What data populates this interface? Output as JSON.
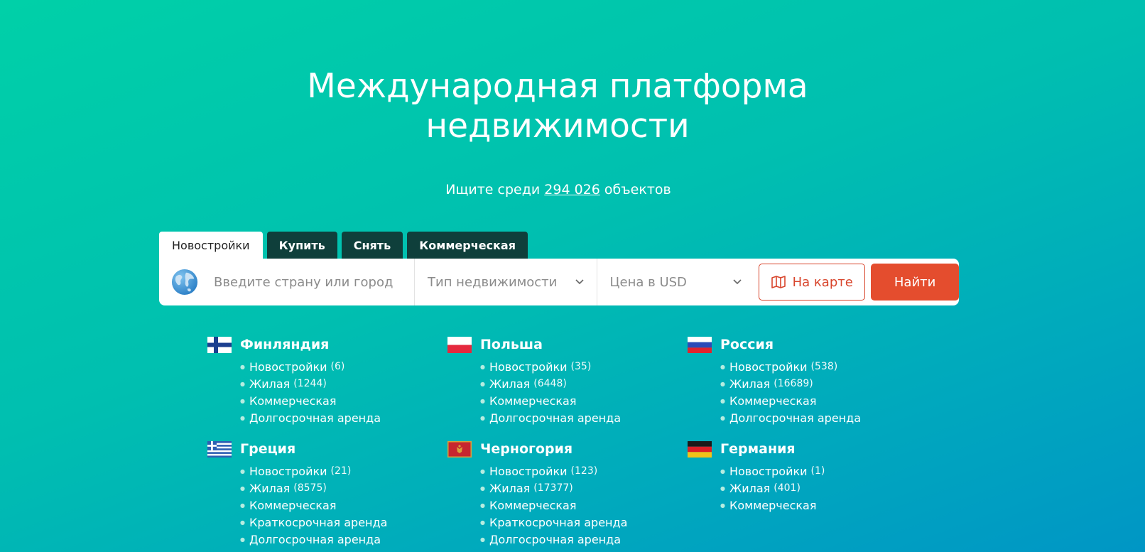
{
  "hero": {
    "title_line1": "Международная платформа",
    "title_line2": "недвижимости",
    "subtitle_prefix": "Ищите среди",
    "subtitle_count": "294 026",
    "subtitle_suffix": "объектов"
  },
  "tabs": [
    {
      "label": "Новостройки",
      "active": true
    },
    {
      "label": "Купить",
      "active": false
    },
    {
      "label": "Снять",
      "active": false
    },
    {
      "label": "Коммерческая",
      "active": false
    }
  ],
  "search": {
    "city_placeholder": "Введите страну или город",
    "type_label": "Тип недвижимости",
    "price_label": "Цена в USD",
    "map_button": "На карте",
    "find_button": "Найти"
  },
  "countries": [
    {
      "name": "Финляндия",
      "flag": "finland-flag",
      "links": [
        {
          "label": "Новостройки",
          "count": "(6)"
        },
        {
          "label": "Жилая",
          "count": "(1244)"
        },
        {
          "label": "Коммерческая",
          "count": ""
        },
        {
          "label": "Долгосрочная аренда",
          "count": ""
        }
      ]
    },
    {
      "name": "Польша",
      "flag": "poland-flag",
      "links": [
        {
          "label": "Новостройки",
          "count": "(35)"
        },
        {
          "label": "Жилая",
          "count": "(6448)"
        },
        {
          "label": "Коммерческая",
          "count": ""
        },
        {
          "label": "Долгосрочная аренда",
          "count": ""
        }
      ]
    },
    {
      "name": "Россия",
      "flag": "russia-flag",
      "links": [
        {
          "label": "Новостройки",
          "count": "(538)"
        },
        {
          "label": "Жилая",
          "count": "(16689)"
        },
        {
          "label": "Коммерческая",
          "count": ""
        },
        {
          "label": "Долгосрочная аренда",
          "count": ""
        }
      ]
    },
    {
      "name": "Греция",
      "flag": "greece-flag",
      "links": [
        {
          "label": "Новостройки",
          "count": "(21)"
        },
        {
          "label": "Жилая",
          "count": "(8575)"
        },
        {
          "label": "Коммерческая",
          "count": ""
        },
        {
          "label": "Краткосрочная аренда",
          "count": ""
        },
        {
          "label": "Долгосрочная аренда",
          "count": ""
        }
      ]
    },
    {
      "name": "Черногория",
      "flag": "montenegro-flag",
      "links": [
        {
          "label": "Новостройки",
          "count": "(123)"
        },
        {
          "label": "Жилая",
          "count": "(17377)"
        },
        {
          "label": "Коммерческая",
          "count": ""
        },
        {
          "label": "Краткосрочная аренда",
          "count": ""
        },
        {
          "label": "Долгосрочная аренда",
          "count": ""
        }
      ]
    },
    {
      "name": "Германия",
      "flag": "germany-flag",
      "links": [
        {
          "label": "Новостройки",
          "count": "(1)"
        },
        {
          "label": "Жилая",
          "count": "(401)"
        },
        {
          "label": "Коммерческая",
          "count": ""
        }
      ]
    }
  ],
  "colors": {
    "accent": "#e44d2e",
    "tab_dark": "#0f3f3b",
    "bg_start": "#00d0a8",
    "bg_end": "#0096c5"
  }
}
